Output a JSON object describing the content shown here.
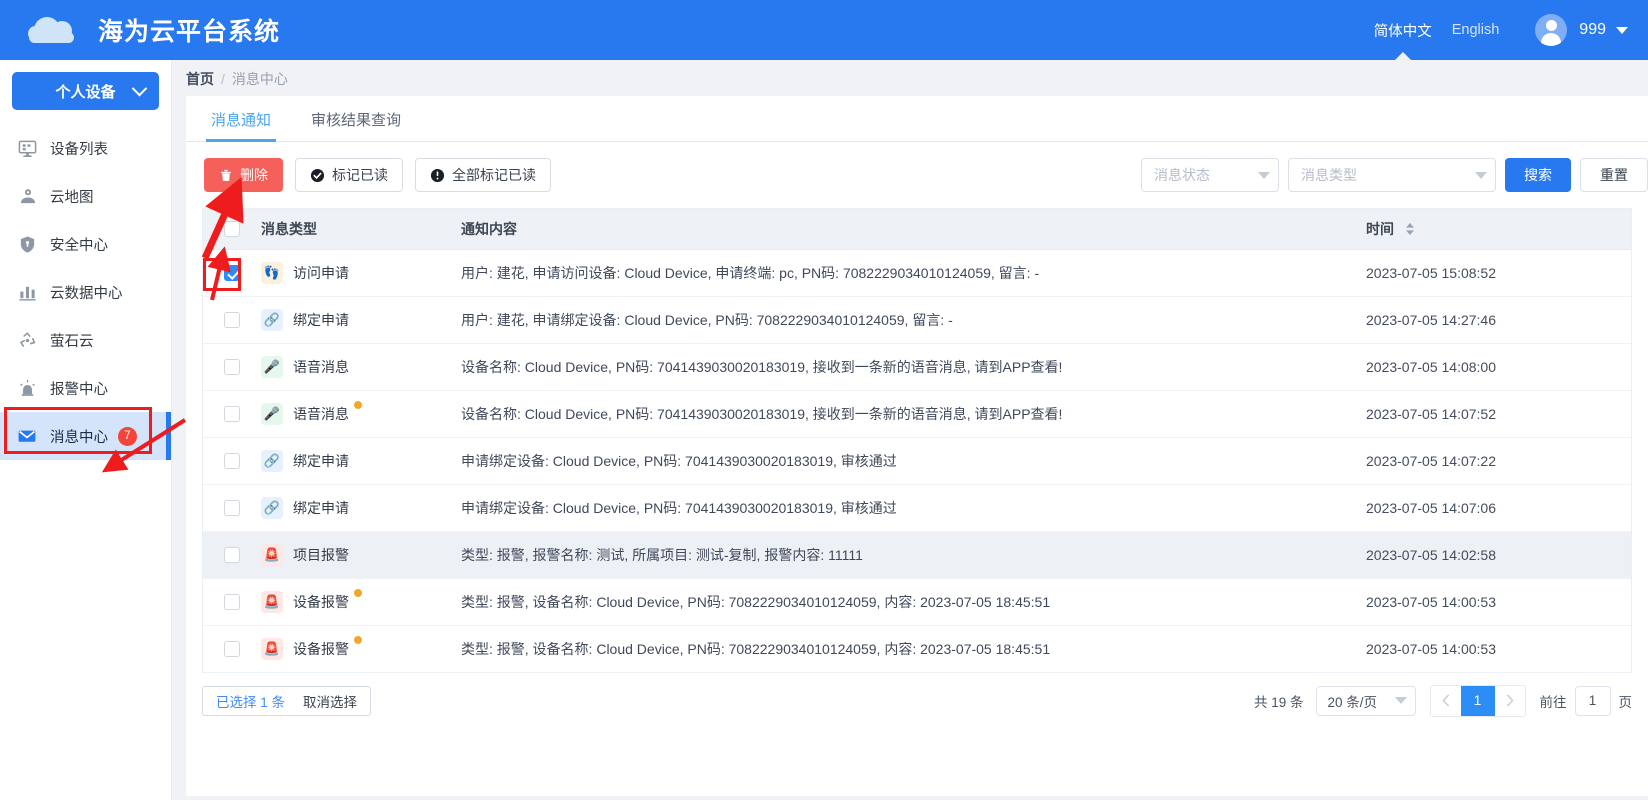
{
  "header": {
    "app_title": "海为云平台系统",
    "logo_icon": "cloud-icon",
    "lang_zh": "简体中文",
    "lang_en": "English",
    "user_name": "999",
    "avatar_icon": "user-avatar-icon",
    "caret_icon": "chevron-down-icon",
    "brand_color": "#2878f0"
  },
  "sidebar": {
    "device_selector": {
      "label": "个人设备",
      "icon": "chevron-down-icon"
    },
    "items": [
      {
        "label": "设备列表",
        "icon": "monitor-icon",
        "active": false,
        "badge": ""
      },
      {
        "label": "云地图",
        "icon": "map-pin-icon",
        "active": false,
        "badge": ""
      },
      {
        "label": "安全中心",
        "icon": "shield-icon",
        "active": false,
        "badge": ""
      },
      {
        "label": "云数据中心",
        "icon": "bar-chart-icon",
        "active": false,
        "badge": ""
      },
      {
        "label": "萤石云",
        "icon": "recycle-icon",
        "active": false,
        "badge": ""
      },
      {
        "label": "报警中心",
        "icon": "siren-icon",
        "active": false,
        "badge": ""
      },
      {
        "label": "消息中心",
        "icon": "envelope-icon",
        "active": true,
        "badge": "7"
      }
    ],
    "active_bg": "#d4e4fb",
    "active_bar": "#2878f0",
    "badge_color": "#f5443a"
  },
  "breadcrumb": {
    "home": "首页",
    "separator": "/",
    "current": "消息中心"
  },
  "tabs": [
    {
      "label": "消息通知",
      "active": true
    },
    {
      "label": "审核结果查询",
      "active": false
    }
  ],
  "toolbar": {
    "delete_label": "删除",
    "delete_icon": "trash-icon",
    "mark_read_label": "标记已读",
    "mark_read_icon": "check-circle-icon",
    "mark_all_read_label": "全部标记已读",
    "mark_all_read_icon": "exclamation-circle-icon",
    "status_placeholder": "消息状态",
    "type_placeholder": "消息类型",
    "search_label": "搜索",
    "reset_label": "重置",
    "dropdown_icon": "chevron-down-icon"
  },
  "table": {
    "headers": {
      "checkbox": "",
      "type": "消息类型",
      "content": "通知内容",
      "time": "时间"
    },
    "sort_icon": "sort-arrows-icon",
    "header_checked": false,
    "rows": [
      {
        "checked": true,
        "striped": false,
        "unread": false,
        "icon": "footprints-icon",
        "icon_class": "ico-visit",
        "icon_glyph": "👣",
        "type": "访问申请",
        "content": "用户: 建花, 申请访问设备: Cloud Device, 申请终端: pc, PN码: 7082229034010124059, 留言: -",
        "time": "2023-07-05 15:08:52"
      },
      {
        "checked": false,
        "striped": false,
        "unread": false,
        "icon": "link-icon",
        "icon_class": "ico-bind",
        "icon_glyph": "🔗",
        "type": "绑定申请",
        "content": "用户: 建花, 申请绑定设备: Cloud Device, PN码: 7082229034010124059, 留言: -",
        "time": "2023-07-05 14:27:46"
      },
      {
        "checked": false,
        "striped": false,
        "unread": false,
        "icon": "microphone-icon",
        "icon_class": "ico-voice",
        "icon_glyph": "🎤",
        "type": "语音消息",
        "content": "设备名称: Cloud Device, PN码: 7041439030020183019, 接收到一条新的语音消息, 请到APP查看!",
        "time": "2023-07-05 14:08:00"
      },
      {
        "checked": false,
        "striped": false,
        "unread": true,
        "icon": "microphone-icon",
        "icon_class": "ico-voice",
        "icon_glyph": "🎤",
        "type": "语音消息",
        "content": "设备名称: Cloud Device, PN码: 7041439030020183019, 接收到一条新的语音消息, 请到APP查看!",
        "time": "2023-07-05 14:07:52"
      },
      {
        "checked": false,
        "striped": false,
        "unread": false,
        "icon": "link-icon",
        "icon_class": "ico-bind",
        "icon_glyph": "🔗",
        "type": "绑定申请",
        "content": "申请绑定设备: Cloud Device, PN码: 7041439030020183019, 审核通过",
        "time": "2023-07-05 14:07:22"
      },
      {
        "checked": false,
        "striped": false,
        "unread": false,
        "icon": "link-icon",
        "icon_class": "ico-bind",
        "icon_glyph": "🔗",
        "type": "绑定申请",
        "content": "申请绑定设备: Cloud Device, PN码: 7041439030020183019, 审核通过",
        "time": "2023-07-05 14:07:06"
      },
      {
        "checked": false,
        "striped": true,
        "unread": false,
        "icon": "siren-icon",
        "icon_class": "ico-alarm",
        "icon_glyph": "🚨",
        "type": "项目报警",
        "content": "类型: 报警, 报警名称: 测试, 所属项目: 测试-复制, 报警内容: 11111",
        "time": "2023-07-05 14:02:58"
      },
      {
        "checked": false,
        "striped": false,
        "unread": true,
        "icon": "siren-icon",
        "icon_class": "ico-alarm",
        "icon_glyph": "🚨",
        "type": "设备报警",
        "content": "类型: 报警, 设备名称: Cloud Device, PN码: 7082229034010124059, 内容: 2023-07-05 18:45:51",
        "time": "2023-07-05 14:00:53"
      },
      {
        "checked": false,
        "striped": false,
        "unread": true,
        "icon": "siren-icon",
        "icon_class": "ico-alarm",
        "icon_glyph": "🚨",
        "type": "设备报警",
        "content": "类型: 报警, 设备名称: Cloud Device, PN码: 7082229034010124059, 内容: 2023-07-05 18:45:51",
        "time": "2023-07-05 14:00:53"
      }
    ]
  },
  "footer": {
    "selected_label": "已选择 1 条",
    "cancel_label": "取消选择",
    "total_label": "共 19 条",
    "page_size": "20 条/页",
    "prev_icon": "chevron-left-icon",
    "next_icon": "chevron-right-icon",
    "current_page": "1",
    "goto_label": "前往",
    "goto_value": "1",
    "page_unit": "页"
  },
  "annotations": {
    "sidebar_box": "highlight-sidebar-message-center",
    "checkbox_box": "highlight-row-checkbox",
    "arrow_color": "#ee1c1c"
  }
}
